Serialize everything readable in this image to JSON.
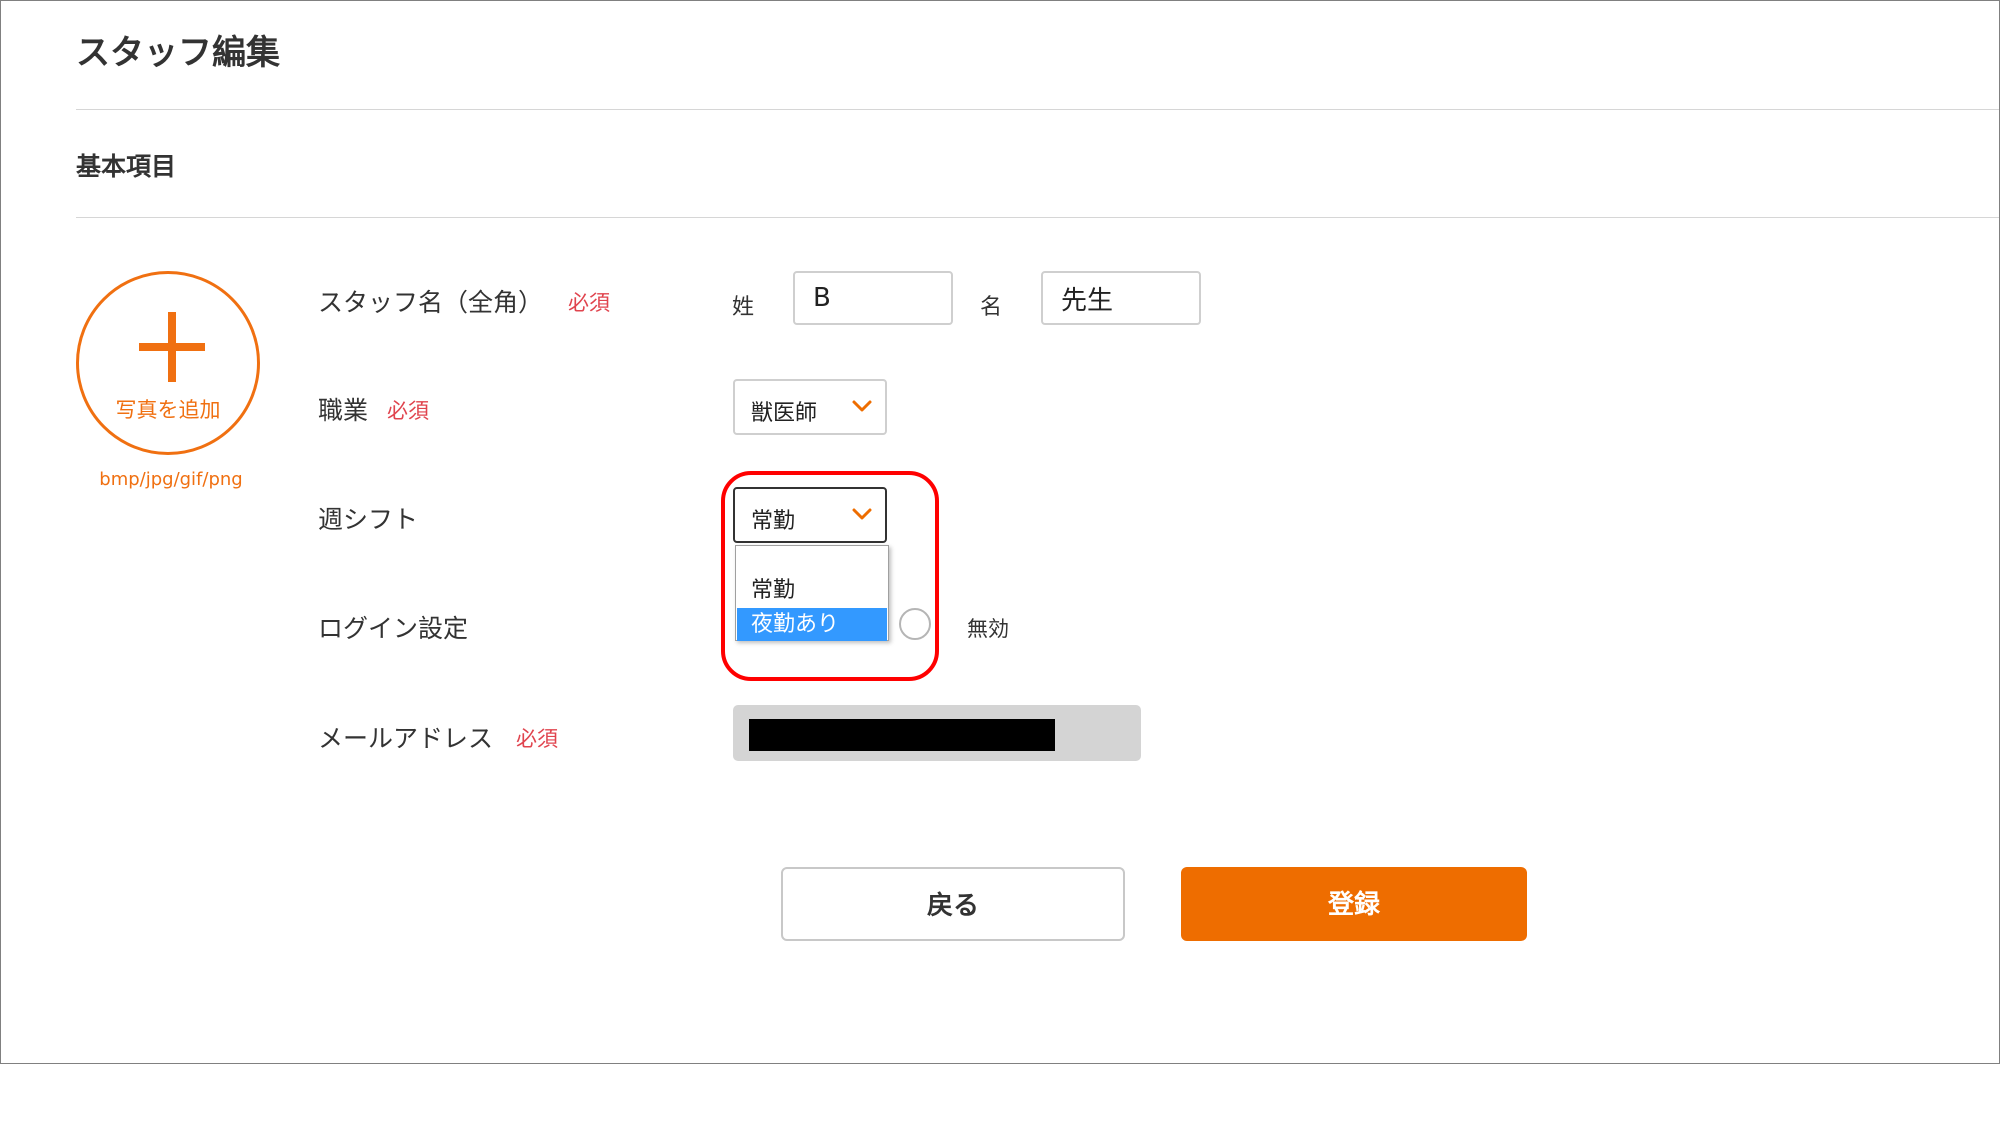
{
  "page": {
    "title": "スタッフ編集"
  },
  "section": {
    "title": "基本項目"
  },
  "photo": {
    "add_label": "写真を追加",
    "formats": "bmp/jpg/gif/png"
  },
  "staff_name": {
    "label": "スタッフ名（全角）",
    "required": "必須",
    "last_label": "姓",
    "last_value": "B",
    "first_label": "名",
    "first_value": "先生"
  },
  "occupation": {
    "label": "職業",
    "required": "必須",
    "selected": "獣医師"
  },
  "weekly_shift": {
    "label": "週シフト",
    "selected": "常勤",
    "options": [
      "常勤",
      "夜勤あり"
    ],
    "highlighted_option": "夜勤あり"
  },
  "login": {
    "label": "ログイン設定",
    "disabled_label": "無効"
  },
  "email": {
    "label": "メールアドレス",
    "required": "必須"
  },
  "buttons": {
    "back": "戻る",
    "register": "登録"
  },
  "colors": {
    "accent": "#ee6d00",
    "required": "#e0444e",
    "highlight_border": "#ff0000",
    "option_selected": "#3399ff"
  }
}
